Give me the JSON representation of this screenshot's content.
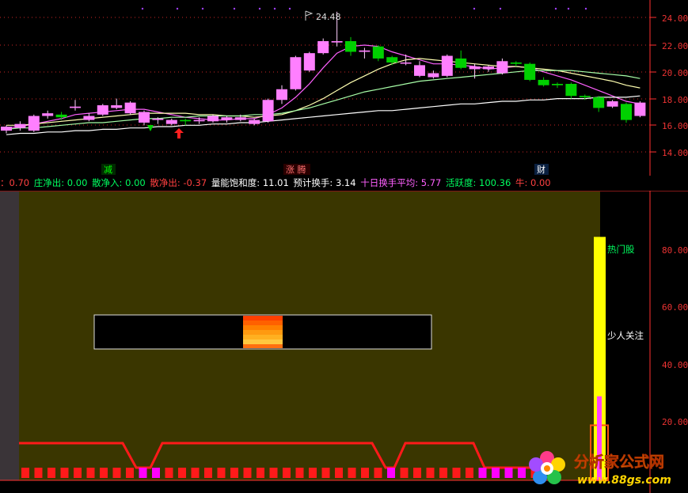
{
  "colors": {
    "up": "#ff7fff",
    "down": "#00d000",
    "ma5": "#ff60ff",
    "ma10": "#ffffb0",
    "ma20": "#a8ffa8",
    "ma60": "#ffffff",
    "axis": "#ff3030",
    "panel_bg": "#3a3600",
    "hot_bar": "#ffff00",
    "label_green": "#00ff60",
    "label_white": "#ffffff"
  },
  "price_chart": {
    "y_ticks": [
      "24.00",
      "22.00",
      "20.00",
      "18.00",
      "16.00",
      "14.00"
    ],
    "high_label": "24.48",
    "signals": [
      {
        "text": "减",
        "color": "#00ff00"
      },
      {
        "text": "涨 腾",
        "color": "#ff6060"
      },
      {
        "text": "财",
        "color": "#ffffff"
      }
    ]
  },
  "chart_data": {
    "type": "candlestick",
    "ylim": [
      13.0,
      25.2
    ],
    "candles": [
      [
        15.6,
        15.9,
        15.4,
        16.0
      ],
      [
        15.8,
        16.1,
        15.6,
        16.3
      ],
      [
        15.6,
        16.7,
        15.5,
        16.8
      ],
      [
        16.7,
        16.9,
        16.5,
        17.1
      ],
      [
        16.8,
        16.6,
        16.4,
        17.0
      ],
      [
        17.3,
        17.4,
        17.1,
        17.9
      ],
      [
        16.4,
        16.7,
        16.3,
        16.9
      ],
      [
        16.8,
        17.5,
        16.7,
        17.6
      ],
      [
        17.3,
        17.5,
        17.2,
        18.0
      ],
      [
        16.9,
        17.7,
        16.8,
        17.8
      ],
      [
        16.2,
        17.0,
        16.0,
        17.1
      ],
      [
        16.4,
        16.5,
        16.1,
        16.6
      ],
      [
        16.1,
        16.4,
        16.0,
        16.5
      ],
      [
        16.4,
        16.3,
        16.0,
        16.5
      ],
      [
        16.3,
        16.4,
        16.1,
        16.6
      ],
      [
        16.3,
        16.7,
        16.2,
        16.8
      ],
      [
        16.4,
        16.6,
        16.2,
        16.7
      ],
      [
        16.4,
        16.6,
        16.3,
        16.8
      ],
      [
        16.1,
        16.4,
        16.0,
        16.5
      ],
      [
        16.3,
        17.9,
        16.2,
        18.0
      ],
      [
        17.9,
        18.7,
        17.6,
        19.0
      ],
      [
        18.7,
        21.1,
        18.6,
        21.2
      ],
      [
        20.1,
        21.4,
        20.0,
        21.5
      ],
      [
        21.4,
        22.3,
        21.3,
        22.5
      ],
      [
        22.2,
        22.3,
        21.9,
        24.5
      ],
      [
        22.3,
        21.5,
        21.2,
        22.6
      ],
      [
        21.5,
        21.6,
        21.0,
        21.8
      ],
      [
        21.9,
        21.0,
        20.8,
        22.0
      ],
      [
        21.1,
        20.7,
        20.5,
        21.2
      ],
      [
        20.7,
        20.7,
        20.5,
        21.3
      ],
      [
        19.7,
        20.5,
        19.6,
        20.8
      ],
      [
        19.6,
        19.9,
        19.5,
        20.1
      ],
      [
        19.7,
        21.2,
        19.6,
        21.3
      ],
      [
        21.0,
        20.3,
        20.2,
        21.6
      ],
      [
        20.2,
        20.4,
        19.5,
        20.6
      ],
      [
        20.2,
        20.4,
        20.0,
        20.5
      ],
      [
        19.9,
        20.8,
        19.8,
        21.0
      ],
      [
        20.7,
        20.6,
        20.4,
        20.8
      ],
      [
        20.6,
        19.4,
        19.3,
        20.7
      ],
      [
        19.4,
        19.0,
        18.9,
        19.6
      ],
      [
        19.1,
        19.0,
        18.8,
        19.2
      ],
      [
        19.1,
        18.2,
        18.0,
        19.2
      ],
      [
        18.2,
        18.1,
        17.9,
        18.3
      ],
      [
        18.1,
        17.3,
        17.0,
        18.2
      ],
      [
        17.4,
        17.8,
        17.3,
        17.9
      ],
      [
        17.6,
        16.4,
        16.2,
        17.7
      ],
      [
        16.7,
        17.7,
        16.6,
        17.8
      ]
    ],
    "ma_series": [
      {
        "key": "ma5",
        "values": [
          15.8,
          15.9,
          16.1,
          16.3,
          16.5,
          16.8,
          16.9,
          17.0,
          17.1,
          17.2,
          17.2,
          17.0,
          16.8,
          16.6,
          16.5,
          16.4,
          16.4,
          16.5,
          16.5,
          16.8,
          17.3,
          18.1,
          19.1,
          20.3,
          21.4,
          21.9,
          22.0,
          21.9,
          21.5,
          21.2,
          20.9,
          20.6,
          20.6,
          20.5,
          20.4,
          20.2,
          20.3,
          20.4,
          20.3,
          20.0,
          19.7,
          19.4,
          19.0,
          18.6,
          18.2,
          17.8,
          17.6
        ]
      },
      {
        "key": "ma10",
        "values": [
          16.0,
          16.0,
          16.1,
          16.2,
          16.3,
          16.4,
          16.5,
          16.6,
          16.7,
          16.8,
          16.9,
          16.9,
          16.9,
          16.9,
          16.8,
          16.8,
          16.7,
          16.7,
          16.6,
          16.7,
          16.8,
          17.1,
          17.5,
          18.0,
          18.6,
          19.2,
          19.7,
          20.2,
          20.6,
          20.9,
          21.0,
          20.9,
          20.8,
          20.7,
          20.6,
          20.5,
          20.4,
          20.4,
          20.3,
          20.2,
          20.1,
          19.9,
          19.7,
          19.5,
          19.3,
          19.0,
          18.8
        ]
      },
      {
        "key": "ma20",
        "values": [
          15.7,
          15.8,
          15.8,
          15.9,
          16.0,
          16.1,
          16.2,
          16.2,
          16.3,
          16.4,
          16.5,
          16.5,
          16.6,
          16.6,
          16.7,
          16.7,
          16.7,
          16.7,
          16.8,
          16.8,
          16.9,
          17.1,
          17.3,
          17.6,
          17.9,
          18.2,
          18.5,
          18.7,
          18.9,
          19.1,
          19.3,
          19.4,
          19.5,
          19.6,
          19.7,
          19.8,
          19.9,
          20.0,
          20.1,
          20.1,
          20.1,
          20.1,
          20.0,
          19.9,
          19.8,
          19.7,
          19.5
        ]
      },
      {
        "key": "ma60",
        "values": [
          15.3,
          15.4,
          15.4,
          15.5,
          15.5,
          15.6,
          15.6,
          15.7,
          15.7,
          15.8,
          15.8,
          15.9,
          15.9,
          16.0,
          16.0,
          16.1,
          16.1,
          16.2,
          16.2,
          16.3,
          16.4,
          16.5,
          16.6,
          16.7,
          16.8,
          16.9,
          17.0,
          17.1,
          17.1,
          17.2,
          17.3,
          17.4,
          17.5,
          17.6,
          17.6,
          17.7,
          17.8,
          17.8,
          17.9,
          17.9,
          18.0,
          18.0,
          18.0,
          18.1,
          18.1,
          18.1,
          18.2
        ]
      }
    ]
  },
  "info_bar": [
    {
      "text": "：0.70",
      "color": "#ff4040"
    },
    {
      "text": "庄净出: 0.00",
      "color": "#00ff60"
    },
    {
      "text": "散净入: 0.00",
      "color": "#00ff60"
    },
    {
      "text": "散净出: -0.37",
      "color": "#ff4040"
    },
    {
      "text": "量能饱和度: 11.01",
      "color": "#ffffff"
    },
    {
      "text": "预计换手: 3.14",
      "color": "#ffffff"
    },
    {
      "text": "十日换手平均: 5.77",
      "color": "#ff60ff"
    },
    {
      "text": "活跃度: 100.36",
      "color": "#00ff60"
    },
    {
      "text": "牛: 0.00",
      "color": "#ff4040"
    }
  ],
  "lower_panel": {
    "y_ticks": [
      "80.00",
      "60.00",
      "40.00",
      "20.00"
    ],
    "hot_label": "热门股",
    "few_label": "少人关注",
    "hot_value": 84,
    "activity_value": 29,
    "orange_value": 19,
    "ylim": [
      0,
      100
    ]
  },
  "watermark": {
    "cn": "分析家公式网",
    "url": "www.88gs.com"
  }
}
